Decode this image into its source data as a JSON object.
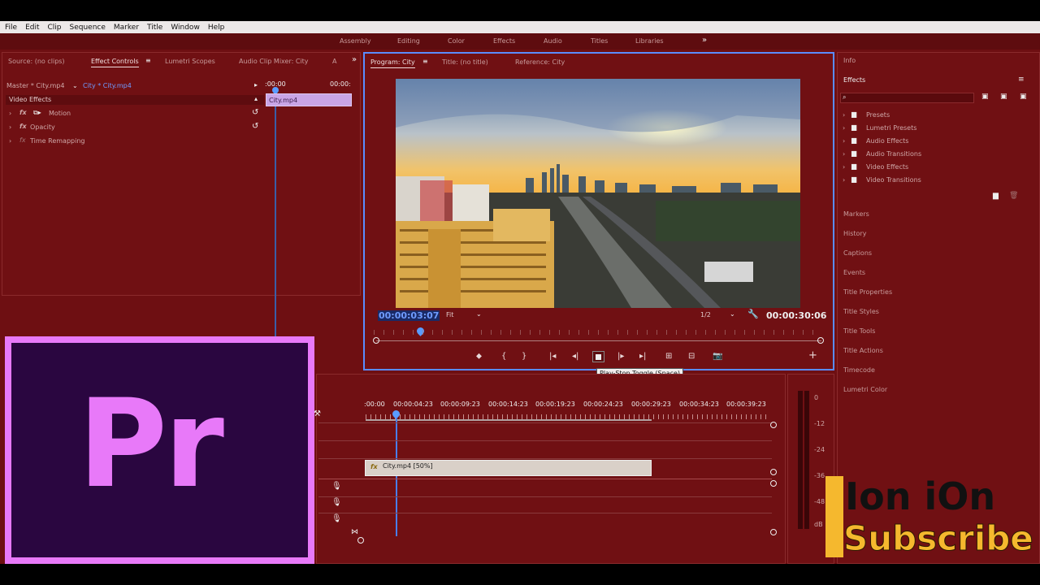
{
  "menu": [
    "File",
    "Edit",
    "Clip",
    "Sequence",
    "Marker",
    "Title",
    "Window",
    "Help"
  ],
  "workspaces": [
    "Assembly",
    "Editing",
    "Color",
    "Effects",
    "Audio",
    "Titles",
    "Libraries"
  ],
  "source_tabs": {
    "source": "Source: (no clips)",
    "effect_controls": "Effect Controls",
    "lumetri": "Lumetri Scopes",
    "audio_mixer": "Audio Clip Mixer: City",
    "overflow": "A"
  },
  "effect_controls": {
    "master": "Master * City.mp4",
    "clip": "City * City.mp4",
    "time_start": ":00:00",
    "time_end": "00:00:",
    "clip_bar": "City.mp4",
    "section": "Video Effects",
    "items": [
      "Motion",
      "Opacity",
      "Time Remapping"
    ]
  },
  "program_tabs": {
    "program": "Program: City",
    "title": "Title: (no title)",
    "reference": "Reference: City"
  },
  "program": {
    "current_tc": "00:00:03:07",
    "fit": "Fit",
    "resolution": "1/2",
    "duration_tc": "00:00:30:06",
    "tooltip": "Play-Stop Toggle (Space)"
  },
  "timeline": {
    "ruler": [
      ":00:00",
      "00:00:04:23",
      "00:00:09:23",
      "00:00:14:23",
      "00:00:19:23",
      "00:00:24:23",
      "00:00:29:23",
      "00:00:34:23",
      "00:00:39:23"
    ],
    "clip": "City.mp4 [50%]"
  },
  "meter": {
    "labels": [
      "0",
      "-12",
      "-24",
      "-36",
      "-48",
      "dB"
    ]
  },
  "right_panel": {
    "info": "Info",
    "effects": "Effects",
    "effect_folders": [
      "Presets",
      "Lumetri Presets",
      "Audio Effects",
      "Audio Transitions",
      "Video Effects",
      "Video Transitions"
    ],
    "items": [
      "Markers",
      "History",
      "Captions",
      "Events",
      "Title Properties",
      "Title Styles",
      "Title Tools",
      "Title Actions",
      "Timecode",
      "Lumetri Color"
    ]
  },
  "overlay": {
    "logo": "Pr",
    "channel": "Ion iOn",
    "subscribe": "Subscribe"
  }
}
